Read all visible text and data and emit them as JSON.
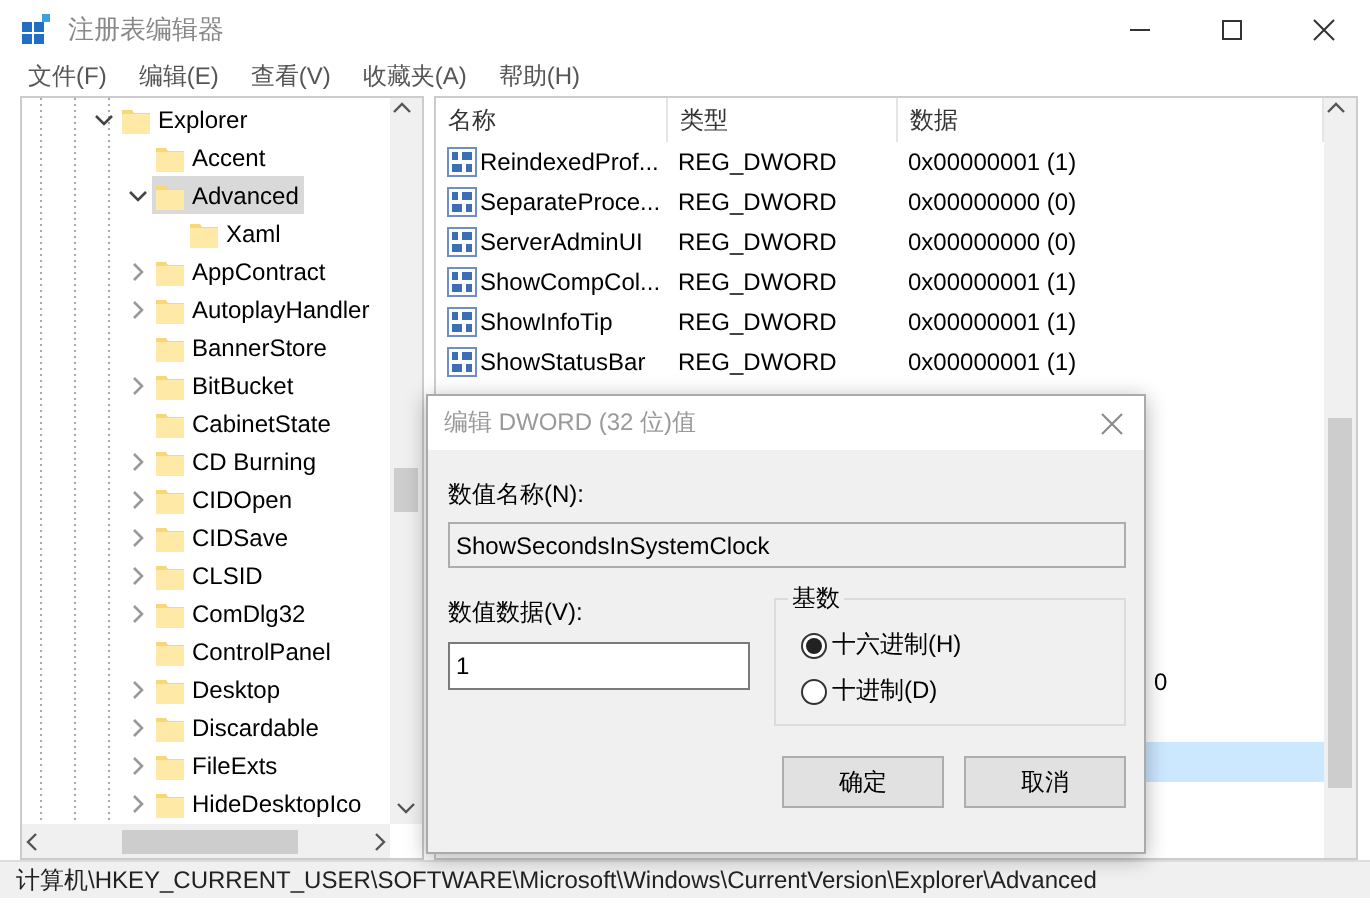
{
  "window": {
    "title": "注册表编辑器"
  },
  "menu": [
    "文件(F)",
    "编辑(E)",
    "查看(V)",
    "收藏夹(A)",
    "帮助(H)"
  ],
  "tree": {
    "items": [
      {
        "label": "Explorer",
        "expandable": true,
        "expanded": true,
        "selected": false,
        "children": [
          {
            "label": "Accent",
            "expandable": false,
            "selected": false
          },
          {
            "label": "Advanced",
            "expandable": true,
            "expanded": true,
            "selected": true,
            "children": [
              {
                "label": "Xaml",
                "expandable": false,
                "selected": false
              }
            ]
          },
          {
            "label": "AppContract",
            "expandable": true,
            "expanded": false,
            "selected": false
          },
          {
            "label": "AutoplayHandler",
            "expandable": true,
            "expanded": false,
            "selected": false
          },
          {
            "label": "BannerStore",
            "expandable": false,
            "selected": false
          },
          {
            "label": "BitBucket",
            "expandable": true,
            "expanded": false,
            "selected": false
          },
          {
            "label": "CabinetState",
            "expandable": false,
            "selected": false
          },
          {
            "label": "CD Burning",
            "expandable": true,
            "expanded": false,
            "selected": false
          },
          {
            "label": "CIDOpen",
            "expandable": true,
            "expanded": false,
            "selected": false
          },
          {
            "label": "CIDSave",
            "expandable": true,
            "expanded": false,
            "selected": false
          },
          {
            "label": "CLSID",
            "expandable": true,
            "expanded": false,
            "selected": false
          },
          {
            "label": "ComDlg32",
            "expandable": true,
            "expanded": false,
            "selected": false
          },
          {
            "label": "ControlPanel",
            "expandable": false,
            "selected": false
          },
          {
            "label": "Desktop",
            "expandable": true,
            "expanded": false,
            "selected": false
          },
          {
            "label": "Discardable",
            "expandable": true,
            "expanded": false,
            "selected": false
          },
          {
            "label": "FileExts",
            "expandable": true,
            "expanded": false,
            "selected": false
          },
          {
            "label": "HideDesktopIco",
            "expandable": true,
            "expanded": false,
            "selected": false
          }
        ]
      }
    ]
  },
  "values": {
    "columns": [
      "名称",
      "类型",
      "数据"
    ],
    "rows": [
      {
        "name": "ReindexedProf...",
        "type": "REG_DWORD",
        "data": "0x00000001 (1)",
        "selected": false
      },
      {
        "name": "SeparateProce...",
        "type": "REG_DWORD",
        "data": "0x00000000 (0)",
        "selected": false
      },
      {
        "name": "ServerAdminUI",
        "type": "REG_DWORD",
        "data": "0x00000000 (0)",
        "selected": false
      },
      {
        "name": "ShowCompCol...",
        "type": "REG_DWORD",
        "data": "0x00000001 (1)",
        "selected": false
      },
      {
        "name": "ShowInfoTip",
        "type": "REG_DWORD",
        "data": "0x00000001 (1)",
        "selected": false
      },
      {
        "name": "ShowStatusBar",
        "type": "REG_DWORD",
        "data": "0x00000001 (1)",
        "selected": false
      }
    ],
    "partly_covered_rows": [
      {
        "data": "0",
        "selected": false
      },
      {
        "selected": true
      }
    ]
  },
  "dialog": {
    "title": "编辑 DWORD (32 位)值",
    "name_label": "数值名称(N):",
    "name_value": "ShowSecondsInSystemClock",
    "data_label": "数值数据(V):",
    "data_value": "1",
    "base_group": "基数",
    "base_options": [
      {
        "label": "十六进制(H)",
        "selected": true
      },
      {
        "label": "十进制(D)",
        "selected": false
      }
    ],
    "buttons": [
      "确定",
      "取消"
    ]
  },
  "status_bar": "计算机\\HKEY_CURRENT_USER\\SOFTWARE\\Microsoft\\Windows\\CurrentVersion\\Explorer\\Advanced"
}
